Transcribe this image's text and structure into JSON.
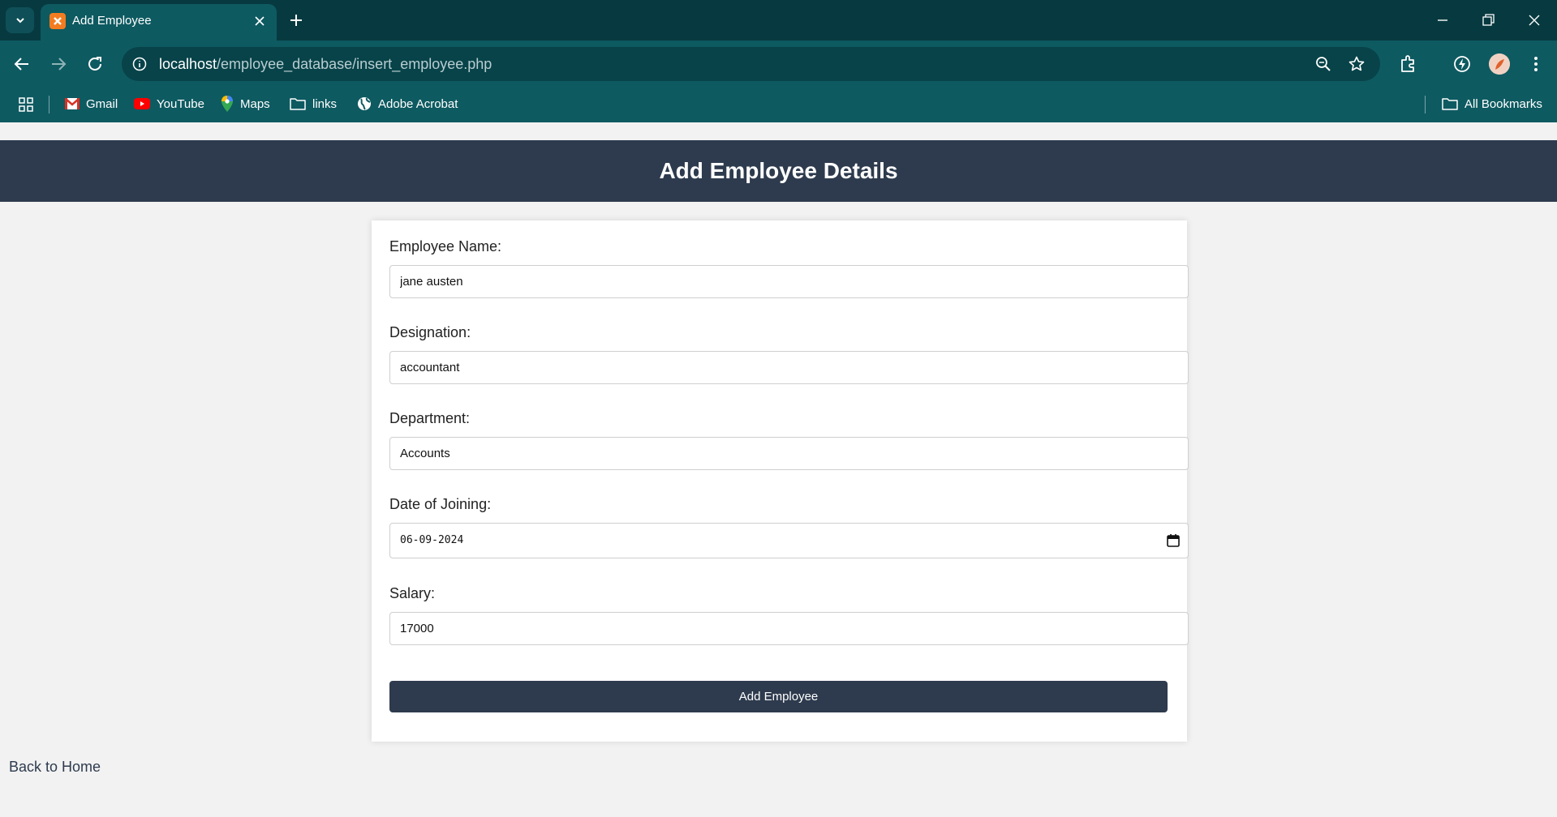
{
  "browser": {
    "tab_title": "Add Employee",
    "url_host": "localhost",
    "url_path": "/employee_database/insert_employee.php",
    "bookmarks": [
      {
        "label": "Gmail",
        "icon": "gmail-icon"
      },
      {
        "label": "YouTube",
        "icon": "youtube-icon"
      },
      {
        "label": "Maps",
        "icon": "maps-icon"
      },
      {
        "label": "links",
        "icon": "folder-icon"
      },
      {
        "label": "Adobe Acrobat",
        "icon": "globe-icon"
      }
    ],
    "all_bookmarks": "All Bookmarks"
  },
  "page": {
    "title": "Add Employee Details",
    "form": {
      "name_label": "Employee Name:",
      "name_value": "jane austen",
      "designation_label": "Designation:",
      "designation_value": "accountant",
      "department_label": "Department:",
      "department_value": "Accounts",
      "doj_label": "Date of Joining:",
      "doj_value": "06-09-2024",
      "salary_label": "Salary:",
      "salary_value": "17000",
      "submit_label": "Add Employee"
    },
    "back_link": "Back to Home"
  },
  "colors": {
    "header_bg": "#2e3b4e",
    "chrome_bg": "#0e5a61",
    "page_bg": "#f2f2f2"
  }
}
